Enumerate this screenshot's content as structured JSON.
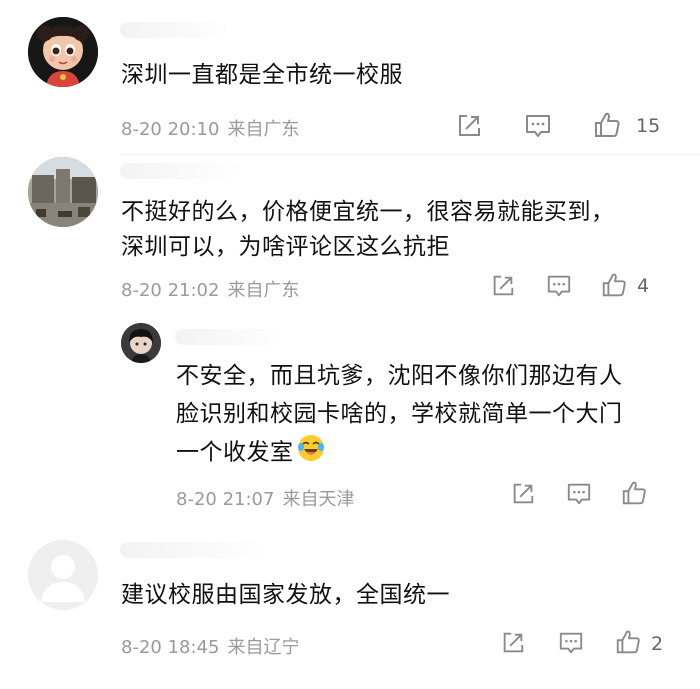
{
  "comments": [
    {
      "text": "深圳一直都是全市统一校服",
      "date": "8-20 20:10",
      "location": "来自广东",
      "likes": "15",
      "avatar_icon": "cartoon-girl-avatar"
    },
    {
      "lines": [
        "不挺好的么，价格便宜统一，很容易就能买到，",
        "深圳可以，为啥评论区这么抗拒"
      ],
      "date": "8-20 21:02",
      "location": "来自广东",
      "likes": "4",
      "avatar_icon": "photo-avatar"
    },
    {
      "lines": [
        "不安全，而且坑爹，沈阳不像你们那边有人",
        "脸识别和校园卡啥的，学校就简单一个大门",
        "一个收发室"
      ],
      "date": "8-20 21:07",
      "location": "来自天津",
      "likes": "",
      "avatar_icon": "anime-boy-avatar",
      "emoji_icon": "laughing-crying-emoji"
    },
    {
      "text": "建议校服由国家发放，全国统一",
      "date": "8-20 18:45",
      "location": "来自辽宁",
      "likes": "2",
      "avatar_icon": "default-user-avatar"
    }
  ],
  "colors": {
    "text": "#111111",
    "meta": "#9a9a9a",
    "icon": "#8a8a8a"
  }
}
